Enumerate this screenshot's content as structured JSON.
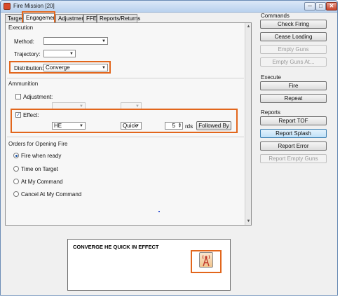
{
  "window": {
    "title": "Fire Mission [20]",
    "minimize": "─",
    "maximize": "□",
    "close": "✕"
  },
  "tabs": [
    "Target",
    "Engagement",
    "Adjustment",
    "FFE",
    "Reports/Returns"
  ],
  "execution": {
    "section": "Execution",
    "method_label": "Method:",
    "method_value": "",
    "trajectory_label": "Trajectory:",
    "trajectory_value": "",
    "distribution_label": "Distribution:",
    "distribution_value": "Converge"
  },
  "ammunition": {
    "section": "Ammunition",
    "adjustment_label": "Adjustment:",
    "adjustment_checked": false,
    "effect_label": "Effect:",
    "effect_checked": true,
    "effect_shell": "HE",
    "effect_fuze": "Quick",
    "effect_rounds": "5",
    "rds_label": "rds",
    "followed_by": "Followed By"
  },
  "orders": {
    "section": "Orders for Opening Fire",
    "options": [
      "Fire when ready",
      "Time on Target",
      "At My Command",
      "Cancel At My Command"
    ],
    "selected": "Fire when ready"
  },
  "message": {
    "text": "CONVERGE HE QUICK IN EFFECT",
    "icon": "radio-tower-icon"
  },
  "commands": {
    "section": "Commands",
    "buttons": [
      "Check Firing",
      "Cease Loading",
      "Empty Guns",
      "Empty Guns At..."
    ]
  },
  "execute": {
    "section": "Execute",
    "buttons": [
      "Fire",
      "Repeat"
    ]
  },
  "reports": {
    "section": "Reports",
    "buttons": [
      "Report TOF",
      "Report Splash",
      "Report Error",
      "Report Empty Guns"
    ]
  },
  "colors": {
    "highlight": "#e2661c",
    "selected_button": "#bfe0f7",
    "title_bar": "#b9d1ee"
  }
}
